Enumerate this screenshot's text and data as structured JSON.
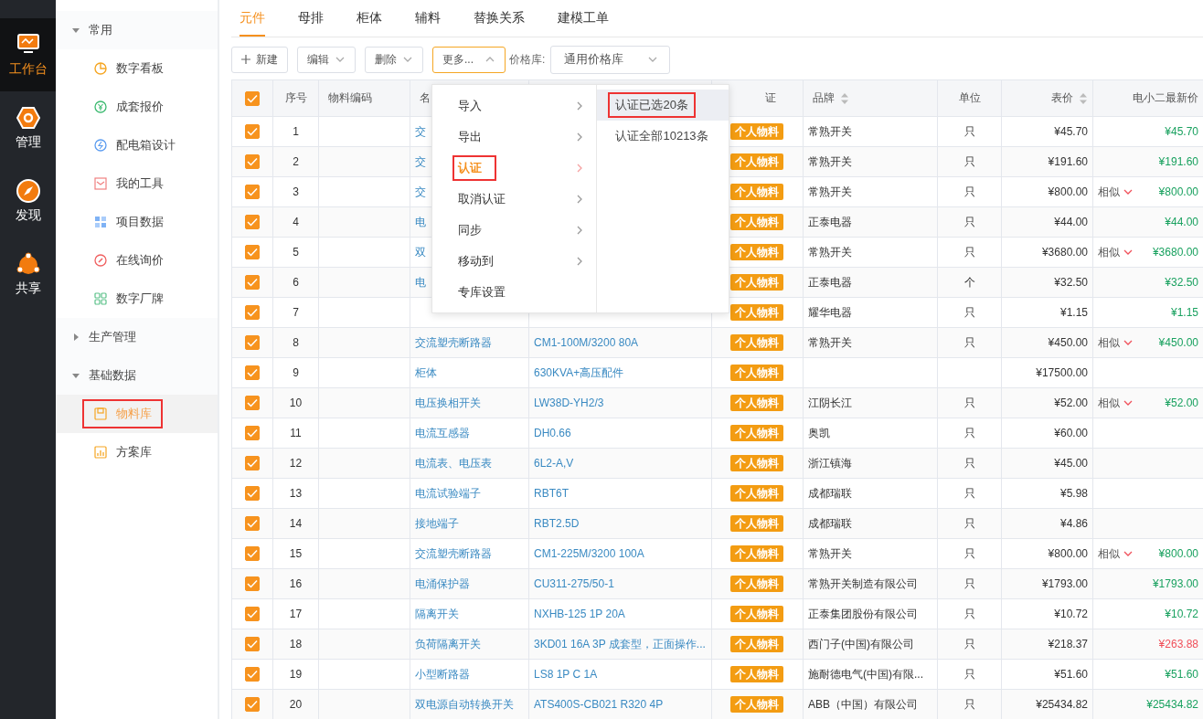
{
  "nav": [
    {
      "label": "工作台",
      "selected": true
    },
    {
      "label": "管理",
      "selected": false
    },
    {
      "label": "发现",
      "selected": false
    },
    {
      "label": "共享",
      "selected": false
    }
  ],
  "sidebar": {
    "groups": [
      {
        "label": "常用",
        "expanded": true,
        "children": [
          {
            "label": "数字看板",
            "selected": false,
            "highlighted": false
          },
          {
            "label": "成套报价",
            "selected": false,
            "highlighted": false
          },
          {
            "label": "配电箱设计",
            "selected": false,
            "highlighted": false
          },
          {
            "label": "我的工具",
            "selected": false,
            "highlighted": false
          },
          {
            "label": "项目数据",
            "selected": false,
            "highlighted": false
          },
          {
            "label": "在线询价",
            "selected": false,
            "highlighted": false
          },
          {
            "label": "数字厂牌",
            "selected": false,
            "highlighted": false
          }
        ]
      },
      {
        "label": "生产管理",
        "expanded": false
      },
      {
        "label": "基础数据",
        "expanded": true,
        "children": [
          {
            "label": "物料库",
            "selected": true,
            "highlighted": true
          },
          {
            "label": "方案库",
            "selected": false,
            "highlighted": false
          }
        ]
      }
    ]
  },
  "tabs": [
    {
      "label": "元件",
      "selected": true
    },
    {
      "label": "母排",
      "selected": false
    },
    {
      "label": "柜体",
      "selected": false
    },
    {
      "label": "辅料",
      "selected": false
    },
    {
      "label": "替换关系",
      "selected": false
    },
    {
      "label": "建模工单",
      "selected": false
    }
  ],
  "toolbar": {
    "buttons": [
      {
        "label": "新建",
        "kind": "add",
        "open": false
      },
      {
        "label": "编辑",
        "kind": "dropdown",
        "open": false
      },
      {
        "label": "删除",
        "kind": "dropdown",
        "open": false
      },
      {
        "label": "更多...",
        "kind": "dropdown",
        "open": true
      }
    ],
    "price_label": "价格库:",
    "price_select": "通用价格库"
  },
  "table": {
    "columns": [
      {
        "kind": "check",
        "checked": true
      },
      {
        "kind": "index",
        "label": "序号"
      },
      {
        "kind": "code",
        "label": "物料编码"
      },
      {
        "kind": "name",
        "label": "名"
      },
      {
        "kind": "model"
      },
      {
        "kind": "tag",
        "label": "证"
      },
      {
        "kind": "brand",
        "label": "品牌",
        "sortable": true
      },
      {
        "kind": "unit",
        "label": "单位"
      },
      {
        "kind": "price",
        "label": "表价",
        "sortable": true
      },
      {
        "kind": "latest",
        "label": "电小二最新价"
      }
    ],
    "rows": [
      {
        "checked": true,
        "no": "1",
        "name": "交",
        "tag": "个人物料",
        "brand": "常熟开关",
        "unit": "只",
        "price": "¥45.70",
        "latest": "¥45.70",
        "color": "#19a15f"
      },
      {
        "checked": true,
        "no": "2",
        "name": "交",
        "tag": "个人物料",
        "brand": "常熟开关",
        "unit": "只",
        "price": "¥191.60",
        "latest": "¥191.60",
        "color": "#19a15f"
      },
      {
        "checked": true,
        "no": "3",
        "name": "交",
        "tag": "个人物料",
        "brand": "常熟开关",
        "unit": "只",
        "price": "¥800.00",
        "similar": "相似",
        "latest": "¥800.00",
        "color": "#19a15f"
      },
      {
        "checked": true,
        "no": "4",
        "name": "电",
        "tag": "个人物料",
        "brand": "正泰电器",
        "unit": "只",
        "price": "¥44.00",
        "latest": "¥44.00",
        "color": "#19a15f"
      },
      {
        "checked": true,
        "no": "5",
        "name": "双",
        "tag": "个人物料",
        "brand": "常熟开关",
        "unit": "只",
        "price": "¥3680.00",
        "similar": "相似",
        "latest": "¥3680.00",
        "color": "#19a15f"
      },
      {
        "checked": true,
        "no": "6",
        "name": "电",
        "tag": "个人物料",
        "brand": "正泰电器",
        "unit": "个",
        "price": "¥32.50",
        "latest": "¥32.50",
        "color": "#19a15f"
      },
      {
        "checked": true,
        "no": "7",
        "tag": "个人物料",
        "brand": "耀华电器",
        "unit": "只",
        "price": "¥1.15",
        "latest": "¥1.15",
        "color": "#19a15f"
      },
      {
        "checked": true,
        "no": "8",
        "name": "交流塑壳断路器",
        "model": "CM1-100M/3200 80A",
        "tag": "个人物料",
        "brand": "常熟开关",
        "unit": "只",
        "price": "¥450.00",
        "similar": "相似",
        "latest": "¥450.00",
        "color": "#19a15f"
      },
      {
        "checked": true,
        "no": "9",
        "name": "柜体",
        "model": "630KVA+高压配件",
        "tag": "个人物料",
        "price": "¥17500.00"
      },
      {
        "checked": true,
        "no": "10",
        "name": "电压换相开关",
        "model": "LW38D-YH2/3",
        "tag": "个人物料",
        "brand": "江阴长江",
        "unit": "只",
        "price": "¥52.00",
        "similar": "相似",
        "latest": "¥52.00",
        "color": "#19a15f"
      },
      {
        "checked": true,
        "no": "11",
        "name": "电流互感器",
        "model": "DH0.66",
        "tag": "个人物料",
        "brand": "奥凯",
        "unit": "只",
        "price": "¥60.00"
      },
      {
        "checked": true,
        "no": "12",
        "name": "电流表、电压表",
        "model": "6L2-A,V",
        "tag": "个人物料",
        "brand": "浙江镇海",
        "unit": "只",
        "price": "¥45.00"
      },
      {
        "checked": true,
        "no": "13",
        "name": "电流试验端子",
        "model": "RBT6T",
        "tag": "个人物料",
        "brand": "成都瑞联",
        "unit": "只",
        "price": "¥5.98"
      },
      {
        "checked": true,
        "no": "14",
        "name": "接地端子",
        "model": "RBT2.5D",
        "tag": "个人物料",
        "brand": "成都瑞联",
        "unit": "只",
        "price": "¥4.86"
      },
      {
        "checked": true,
        "no": "15",
        "name": "交流塑壳断路器",
        "model": "CM1-225M/3200 100A",
        "tag": "个人物料",
        "brand": "常熟开关",
        "unit": "只",
        "price": "¥800.00",
        "similar": "相似",
        "latest": "¥800.00",
        "color": "#19a15f"
      },
      {
        "checked": true,
        "no": "16",
        "name": "电涌保护器",
        "model": "CU311-275/50-1",
        "tag": "个人物料",
        "brand": "常熟开关制造有限公司",
        "unit": "只",
        "price": "¥1793.00",
        "latest": "¥1793.00",
        "color": "#19a15f"
      },
      {
        "checked": true,
        "no": "17",
        "name": "隔离开关",
        "model": "NXHB-125 1P 20A",
        "tag": "个人物料",
        "brand": "正泰集团股份有限公司",
        "unit": "只",
        "price": "¥10.72",
        "latest": "¥10.72",
        "color": "#19a15f"
      },
      {
        "checked": true,
        "no": "18",
        "name": "负荷隔离开关",
        "model": "3KD01 16A 3P 成套型，正面操作...",
        "tag": "个人物料",
        "brand": "西门子(中国)有限公司",
        "unit": "只",
        "price": "¥218.37",
        "latest": "¥263.88",
        "color": "#f0505a"
      },
      {
        "checked": true,
        "no": "19",
        "name": "小型断路器",
        "model": "LS8 1P C 1A",
        "tag": "个人物料",
        "brand": "施耐德电气(中国)有限...",
        "unit": "只",
        "price": "¥51.60",
        "latest": "¥51.60",
        "color": "#19a15f"
      },
      {
        "checked": true,
        "no": "20",
        "name": "双电源自动转换开关",
        "model": "ATS400S-CB021 R320 4P",
        "tag": "个人物料",
        "brand": "ABB（中国）有限公司",
        "unit": "只",
        "price": "¥25434.82",
        "latest": "¥25434.82",
        "color": "#19a15f"
      }
    ]
  },
  "menu": {
    "items": [
      {
        "label": "导入",
        "has_submenu": true,
        "selected": false,
        "highlighted": false
      },
      {
        "label": "导出",
        "has_submenu": true,
        "selected": false,
        "highlighted": false
      },
      {
        "label": "认证",
        "has_submenu": true,
        "selected": true,
        "highlighted": true
      },
      {
        "label": "取消认证",
        "has_submenu": true,
        "selected": false,
        "highlighted": false
      },
      {
        "label": "同步",
        "has_submenu": true,
        "selected": false,
        "highlighted": false
      },
      {
        "label": "移动到",
        "has_submenu": true,
        "selected": false,
        "highlighted": false
      },
      {
        "label": "专库设置",
        "has_submenu": false,
        "selected": false,
        "highlighted": false
      }
    ],
    "submenu": [
      {
        "label": "认证已选20条",
        "selected": true,
        "highlighted": true
      },
      {
        "label": "认证全部10213条",
        "selected": false,
        "highlighted": false
      }
    ]
  }
}
